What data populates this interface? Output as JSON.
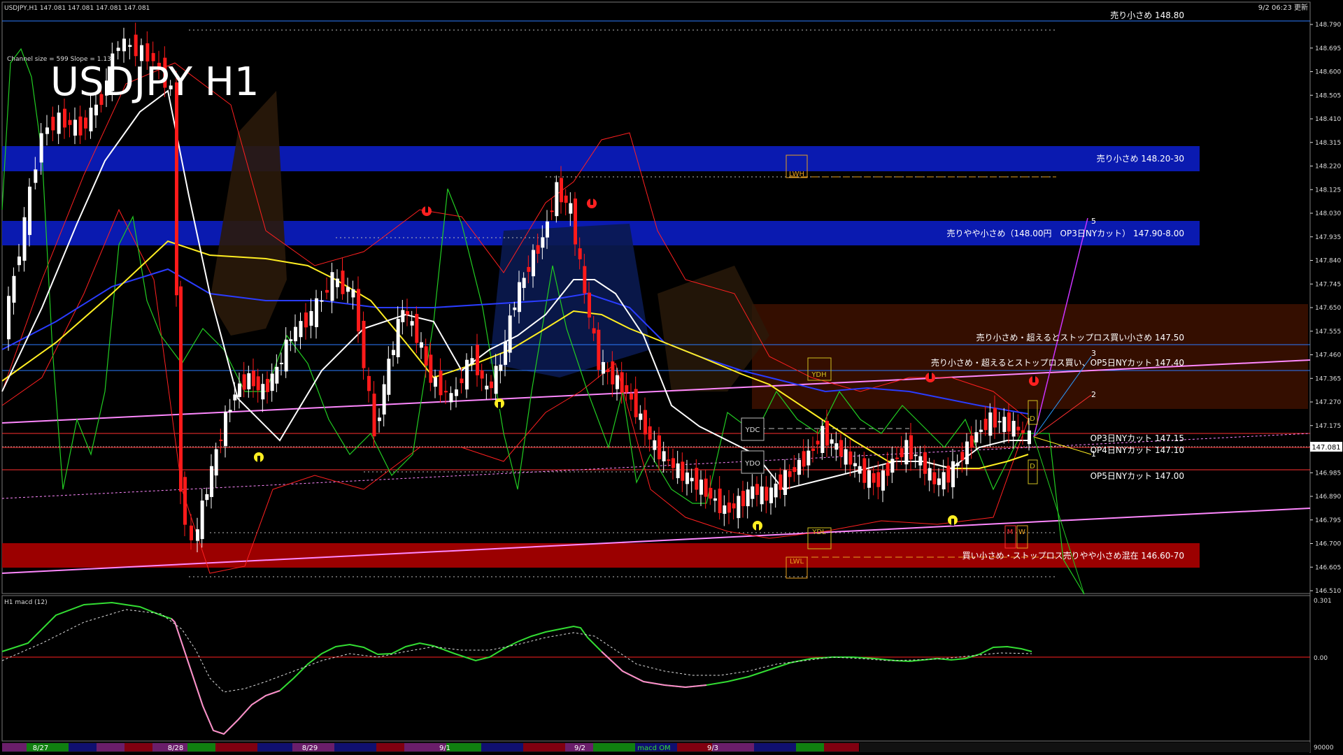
{
  "header": {
    "symbol_info": "USDJPY,H1  147.081 147.081 147.081 147.081",
    "datetime": "9/2 06:23 更新",
    "channel_info": "Channel size = 599 Slope = 1.13",
    "big_title": "USDJPY H1"
  },
  "price_axis": {
    "labels": [
      "148.790",
      "148.695",
      "148.600",
      "148.505",
      "148.410",
      "148.315",
      "148.220",
      "148.125",
      "148.030",
      "147.935",
      "147.840",
      "147.745",
      "147.650",
      "147.555",
      "147.460",
      "147.365",
      "147.270",
      "147.175",
      "147.081",
      "146.985",
      "146.890",
      "146.795",
      "146.700",
      "146.605",
      "146.510"
    ],
    "current_price": "147.081"
  },
  "zones": [
    {
      "label": "売り小さめ 148.20-30",
      "color": "#0a1ab0"
    },
    {
      "label": "売りやや小さめ（148.00円　OP3日NYカット） 147.90-8.00",
      "color": "#0a1ab0"
    },
    {
      "label": "買い小さめ・ストップロス売りやや小さめ混在 146.60-70",
      "color": "#9b0000"
    }
  ],
  "level_labels": [
    "売り小さめ 148.80",
    "売り小さめ・超えるとストップロス買い小さめ 147.50",
    "売り小さめ・超えるとストップロス買い、OP5日NYカット 147.40",
    "OP3日NYカット 147.15",
    "OP4日NYカット 147.10",
    "OP5日NYカット 147.00"
  ],
  "markers": {
    "lwh": "LWH",
    "lwl": "LWL",
    "ydh": "YDH",
    "ydl": "YDL",
    "ydc": "YDC",
    "ydo": "YDO",
    "m": "M",
    "w": "W",
    "d_up": "D",
    "d_down": "D",
    "wave5": "5",
    "wave3": "3",
    "wave2": "2",
    "wave1": "1"
  },
  "macd": {
    "title": "H1  macd (12)",
    "axis_top": "0.301",
    "axis_zero": "0.00",
    "axis_bottom": "90000"
  },
  "time_axis": {
    "dates": [
      "8/27",
      "8/28",
      "8/29",
      "9/1",
      "9/2",
      "9/3"
    ],
    "overlay": "macd OM"
  },
  "colors": {
    "bull": "#ffffff",
    "bear": "#ff1a1a",
    "zone_blue": "#0a1ab0",
    "zone_red": "#9b0000",
    "ma_white": "#ffffff",
    "ma_yellow": "#ffee22",
    "ma_blue": "#2a3cff",
    "trend_pink": "#ff88ff",
    "macd_green": "#33dd33"
  }
}
